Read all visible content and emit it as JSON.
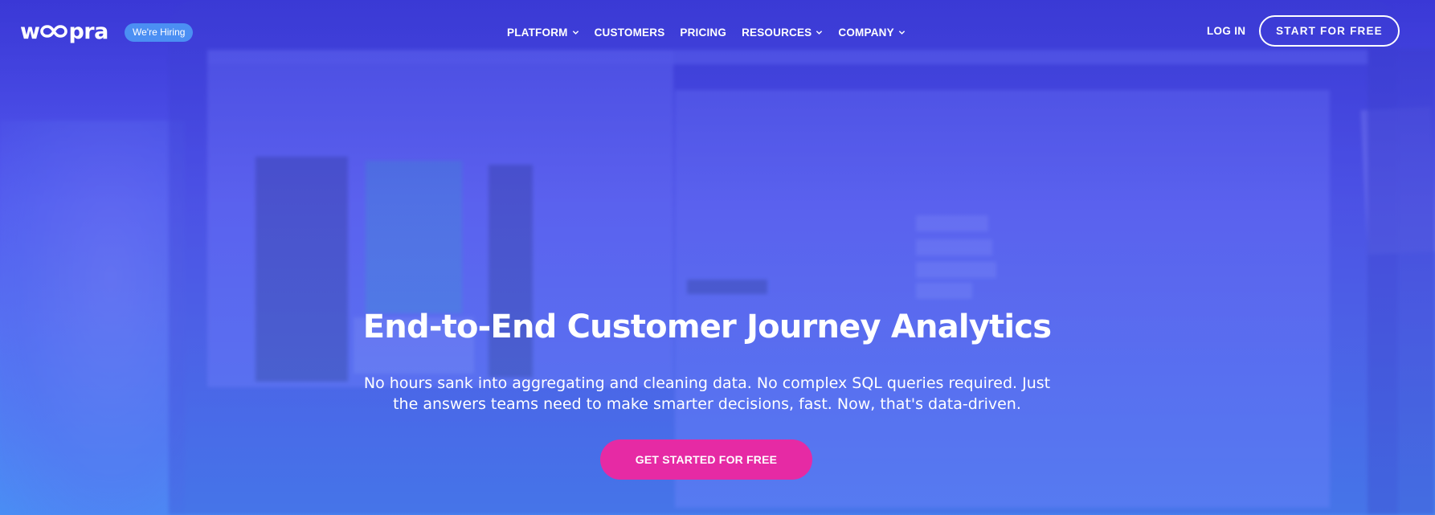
{
  "brand": {
    "logo_text_left": "w",
    "logo_text_right": "pra",
    "logo_icon": "infinity-icon",
    "hiring_badge": "We're Hiring"
  },
  "nav": {
    "items": [
      {
        "label": "PLATFORM",
        "has_dropdown": true
      },
      {
        "label": "CUSTOMERS",
        "has_dropdown": false
      },
      {
        "label": "PRICING",
        "has_dropdown": false
      },
      {
        "label": "RESOURCES",
        "has_dropdown": true
      },
      {
        "label": "COMPANY",
        "has_dropdown": true
      }
    ],
    "login_label": "LOG IN",
    "start_label": "START FOR FREE"
  },
  "hero": {
    "headline": "End-to-End Customer Journey Analytics",
    "sub_line1": "No hours sank into aggregating and cleaning data. No complex SQL queries required. Just",
    "sub_line2": "the answers teams need to make smarter decisions, fast. Now, that's data-driven.",
    "cta_label": "GET STARTED FOR FREE"
  },
  "colors": {
    "hero_top": "#3a38d6",
    "hero_bottom": "#4a8ef4",
    "badge": "#4b8ff3",
    "cta": "#e62aa4",
    "text": "#ffffff"
  }
}
